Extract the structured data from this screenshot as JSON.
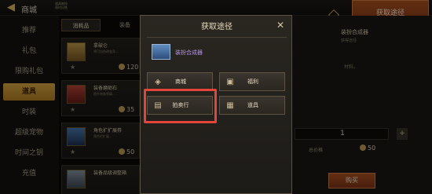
{
  "header": {
    "title": "商城",
    "subtitle_line1": "道具被抢",
    "subtitle_line2": "限时出售",
    "banner_button": "获取途径"
  },
  "sidebar": {
    "items": [
      {
        "label": "推荐",
        "active": false
      },
      {
        "label": "礼包",
        "active": false
      },
      {
        "label": "限购礼包",
        "active": false
      },
      {
        "label": "道具",
        "active": true
      },
      {
        "label": "时装",
        "active": false
      },
      {
        "label": "超级宠物",
        "active": false
      },
      {
        "label": "时间之钥",
        "active": false
      },
      {
        "label": "充值",
        "active": false
      }
    ]
  },
  "tabs": [
    {
      "label": "消耗品",
      "active": true
    },
    {
      "label": "装备",
      "active": false
    }
  ],
  "list": [
    {
      "name": "拿破仑",
      "desc": "将可自由改变身...",
      "price": "120"
    },
    {
      "name": "装备磨砺石",
      "desc": "提升装备等级...",
      "price": "35"
    },
    {
      "name": "角色扩扩展券",
      "desc": "角色栏扩展...",
      "price": "50"
    },
    {
      "name": "装备品级调整箱",
      "desc": "",
      "price": ""
    }
  ],
  "right_panel": {
    "title": "装扮合成器",
    "tag": "获得途径",
    "text": "材料。",
    "quantity": "1",
    "total_label": "总价格",
    "total_price": "50",
    "buy_button": "购买"
  },
  "modal": {
    "title": "获取途径",
    "item_name": "装扮合成器",
    "sources": [
      {
        "label": "商城",
        "icon": "cart-icon"
      },
      {
        "label": "福利",
        "icon": "gift-icon"
      },
      {
        "label": "拍卖行",
        "icon": "auction-icon"
      },
      {
        "label": "道具",
        "icon": "item-icon"
      }
    ]
  },
  "colors": {
    "accent": "#e3b147",
    "highlight": "#e2463a",
    "item_name": "#b792e6"
  }
}
